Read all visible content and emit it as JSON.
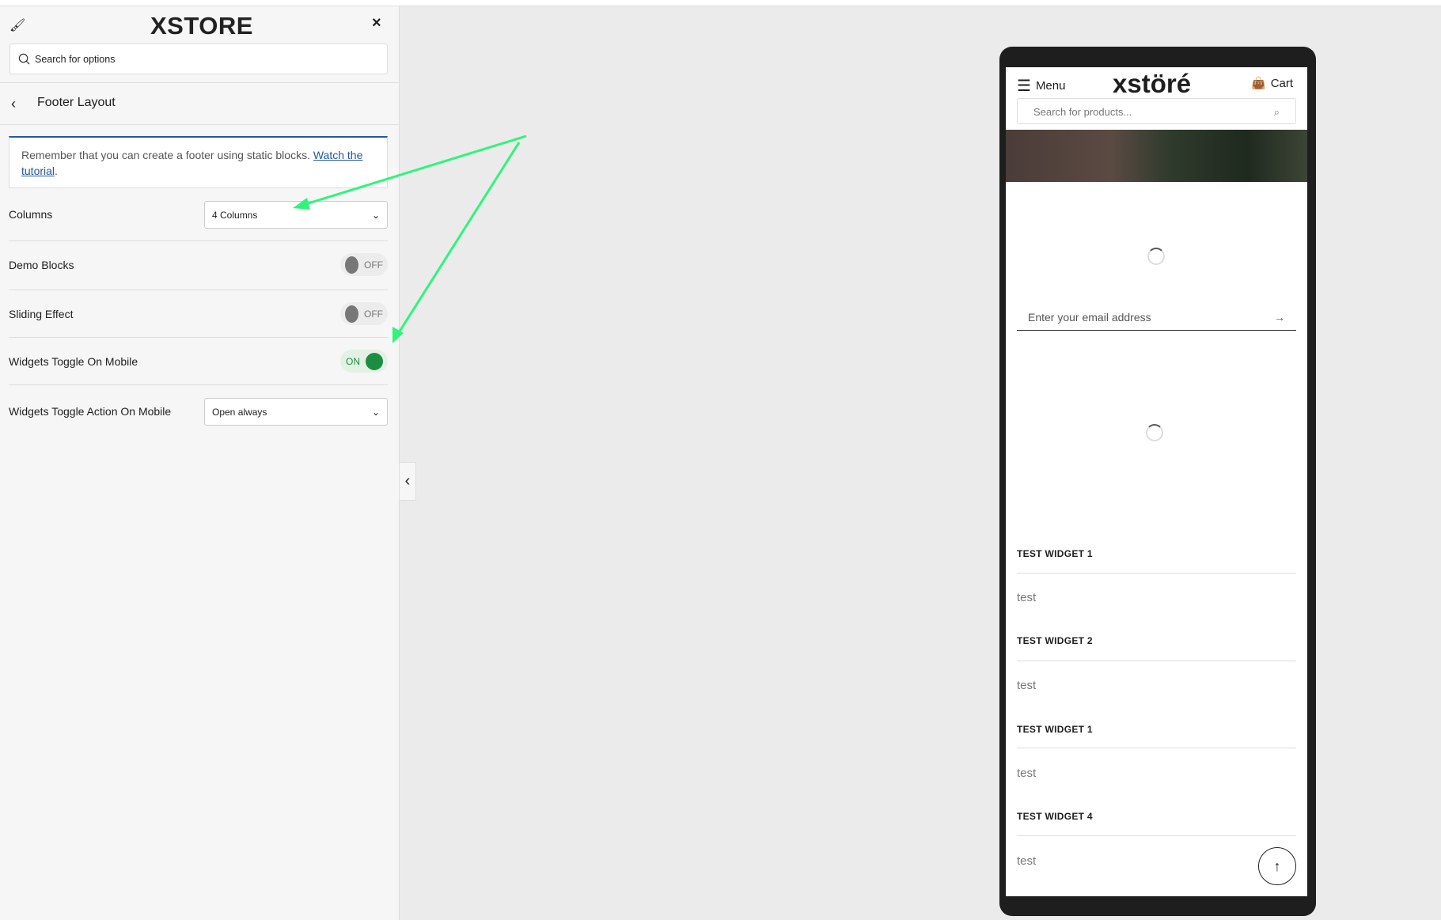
{
  "panel": {
    "logo": "XSTORE",
    "search_placeholder": "Search for options",
    "section_title": "Footer Layout",
    "notice_text": "Remember that you can create a footer using static blocks. ",
    "notice_link": "Watch the tutorial",
    "notice_end": ".",
    "settings": [
      {
        "label": "Columns",
        "type": "select",
        "value": "4 Columns"
      },
      {
        "label": "Demo Blocks",
        "type": "toggle",
        "value": "OFF"
      },
      {
        "label": "Sliding Effect",
        "type": "toggle",
        "value": "OFF"
      },
      {
        "label": "Widgets Toggle On Mobile",
        "type": "toggle",
        "value": "ON"
      },
      {
        "label": "Widgets Toggle Action On Mobile",
        "type": "select",
        "value": "Open always"
      }
    ]
  },
  "preview": {
    "menu_label": "Menu",
    "logo": "xstöré",
    "cart_label": "Cart",
    "search_placeholder": "Search for products...",
    "email_placeholder": "Enter your email address",
    "widgets": [
      {
        "title": "TEST WIDGET 1",
        "text": "test"
      },
      {
        "title": "TEST WIDGET 2",
        "text": "test"
      },
      {
        "title": "TEST WIDGET 1",
        "text": "test"
      },
      {
        "title": "TEST WIDGET 4",
        "text": "test"
      }
    ]
  },
  "colors": {
    "accent": "#2258a6",
    "toggle_on": "#1c8e42",
    "annotation_arrow": "#2ef57a"
  }
}
